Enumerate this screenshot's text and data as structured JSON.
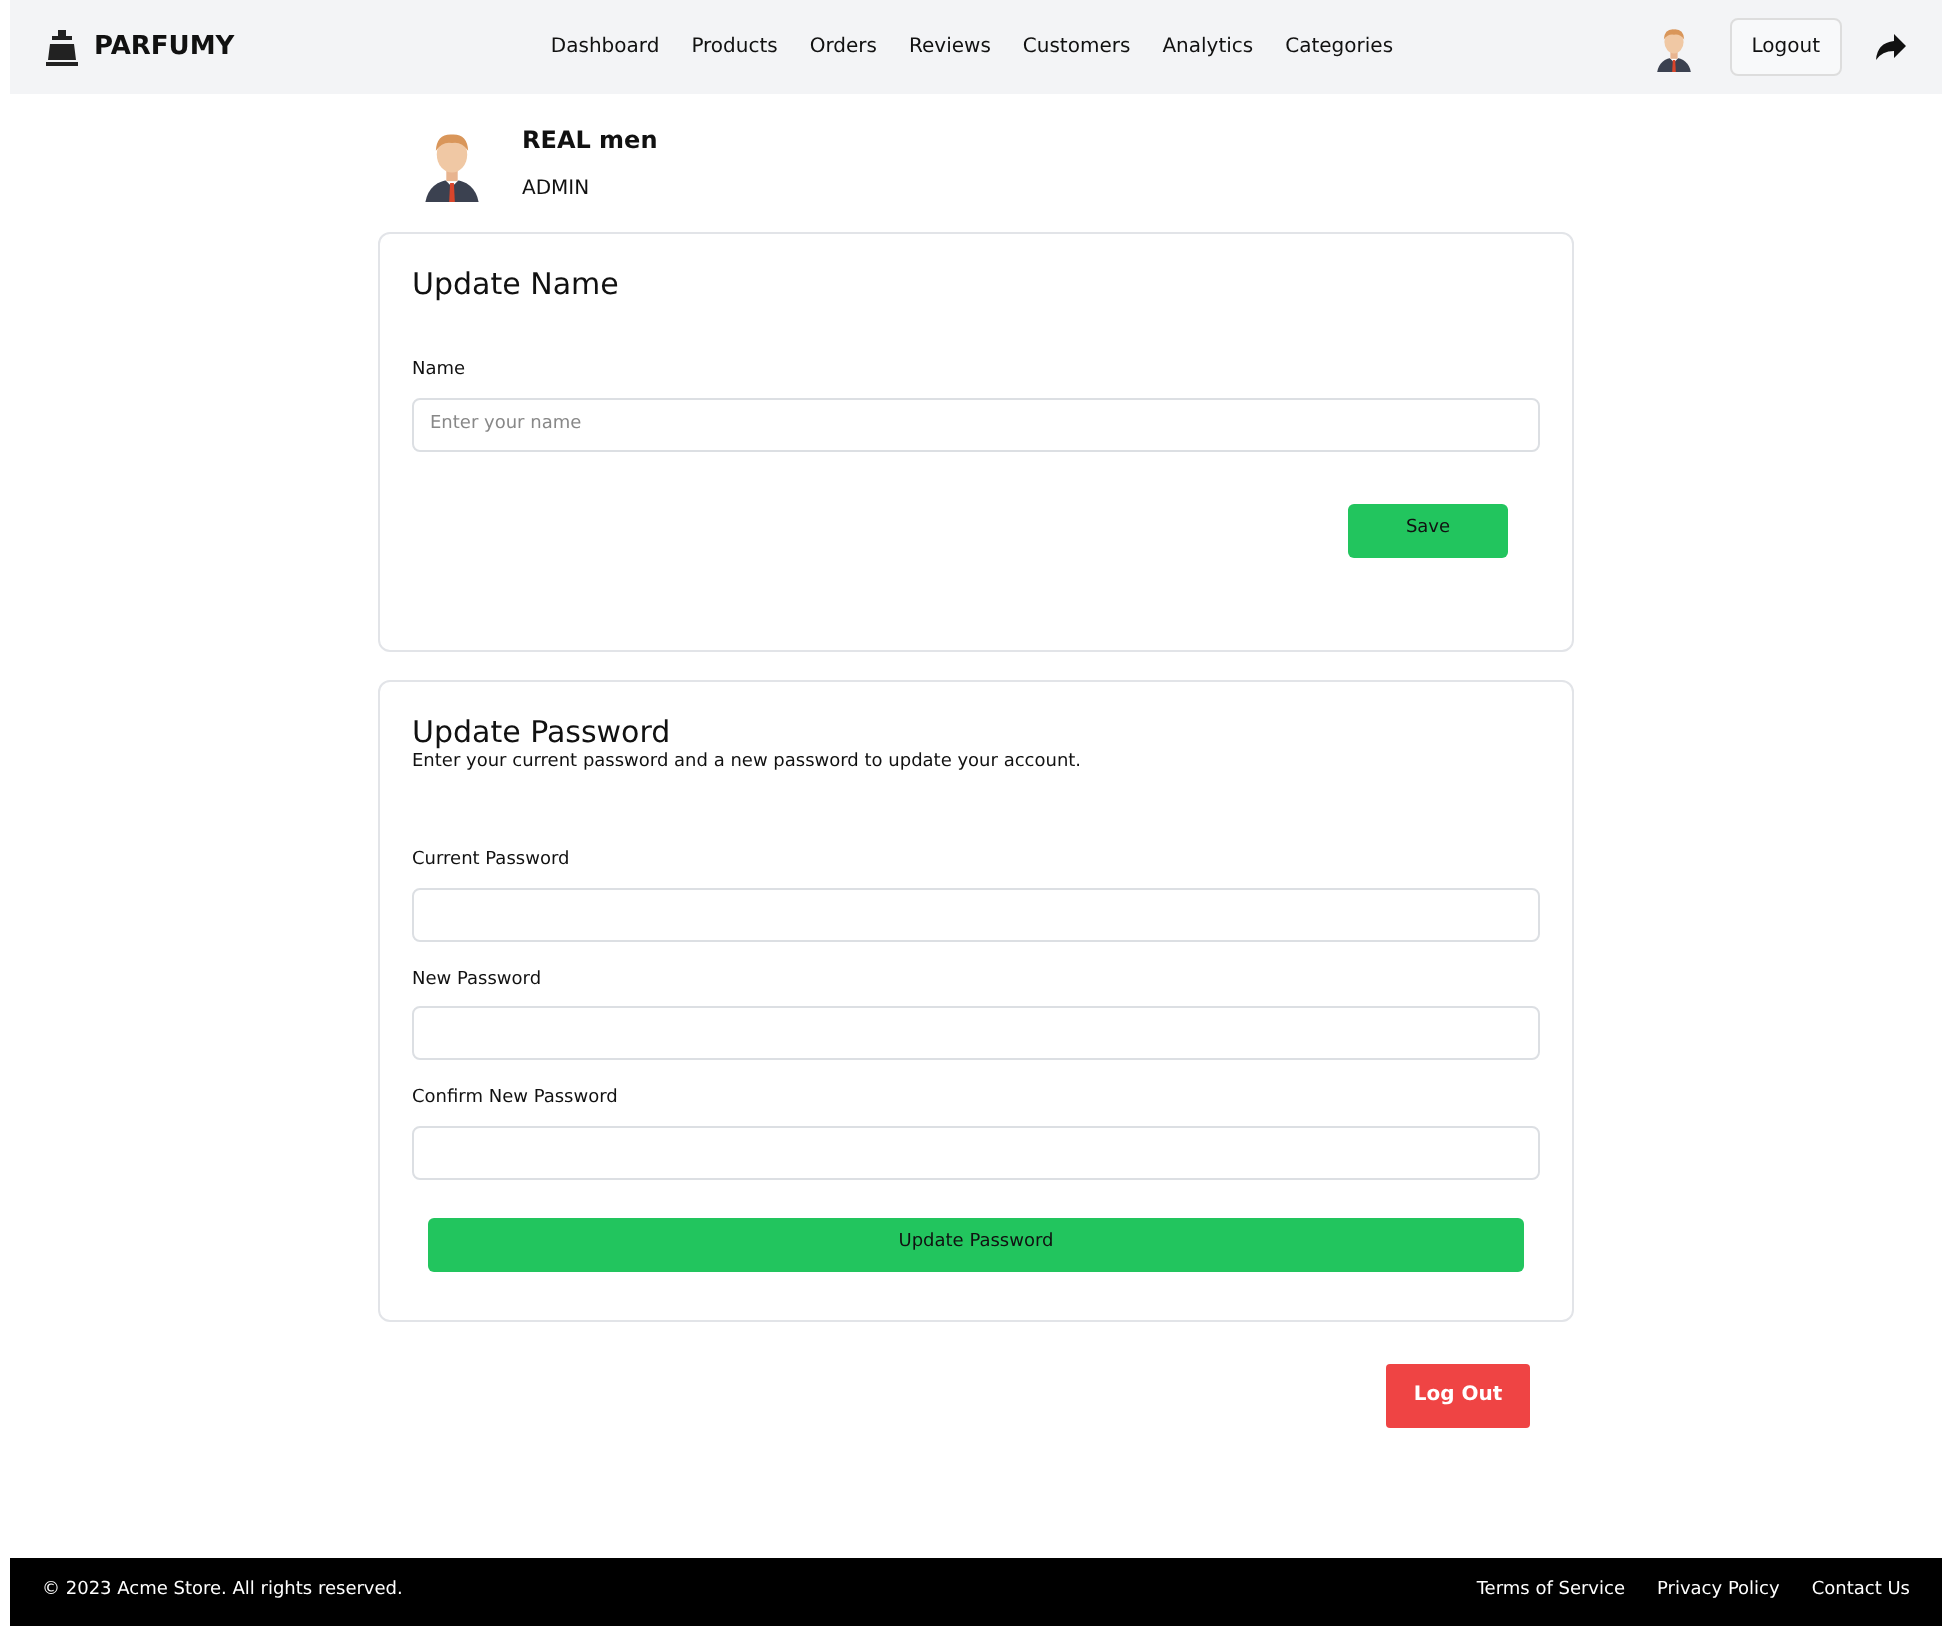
{
  "brand": {
    "name": "PARFUMY"
  },
  "nav": [
    {
      "label": "Dashboard"
    },
    {
      "label": "Products"
    },
    {
      "label": "Orders"
    },
    {
      "label": "Reviews"
    },
    {
      "label": "Customers"
    },
    {
      "label": "Analytics"
    },
    {
      "label": "Categories"
    }
  ],
  "header_actions": {
    "logout": "Logout"
  },
  "profile": {
    "name": "REAL men",
    "role": "ADMIN"
  },
  "name_card": {
    "title": "Update Name",
    "fields": [
      {
        "label": "Name",
        "placeholder": "Enter your name"
      }
    ],
    "button": "Save"
  },
  "password_card": {
    "title": "Update Password",
    "description": "Enter your current password and a new password to update your account.",
    "fields": [
      {
        "label": "Current Password"
      },
      {
        "label": "New Password"
      },
      {
        "label": "Confirm New Password"
      }
    ],
    "button": "Update Password"
  },
  "logout_button": "Log Out",
  "footer": {
    "copyright": "© 2023 Acme Store. All rights reserved.",
    "links": [
      "Terms of Service",
      "Privacy Policy",
      "Contact Us"
    ]
  }
}
